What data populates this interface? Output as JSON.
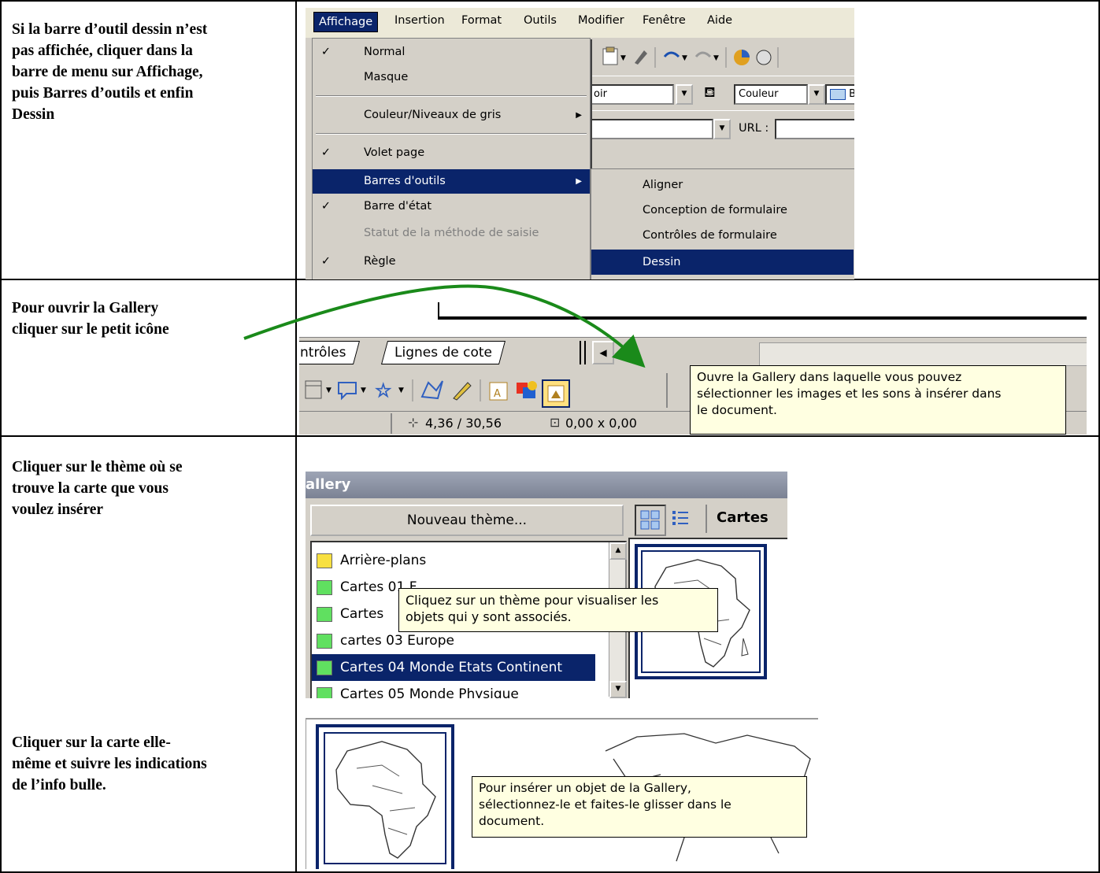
{
  "left_column": {
    "row1": "Si la barre d’outil dessin n’est\npas affichée, cliquer dans la\nbarre de menu sur Affichage,\npuis Barres d’outils et enfin\nDessin",
    "row2": "Pour ouvrir la Gallery\ncliquer sur le petit icône",
    "row3": "Cliquer sur le thème où se\ntrouve la carte que vous\nvoulez insérer",
    "row4": "Cliquer sur la carte elle-\nmême et suivre les indications\nde l’info bulle."
  },
  "menubar": {
    "items": [
      "Affichage",
      "Insertion",
      "Format",
      "Outils",
      "Modifier",
      "Fenêtre",
      "Aide"
    ]
  },
  "toolbar": {
    "combo_left": "oir",
    "combo_color": "Couleur",
    "combo_right": "B",
    "url_label": "URL :"
  },
  "affichage_menu": {
    "items": [
      {
        "label": "Normal",
        "checked": "✓"
      },
      {
        "label": "Masque",
        "checked": ""
      },
      {
        "label": "Couleur/Niveaux de gris",
        "checked": "",
        "arrow": "▶"
      },
      {
        "label": "Volet page",
        "checked": "✓"
      },
      {
        "label": "Barres d'outils",
        "checked": "",
        "arrow": "▶"
      },
      {
        "label": "Barre d'état",
        "checked": "✓"
      },
      {
        "label": "Statut de la méthode de saisie",
        "checked": ""
      },
      {
        "label": "Règle",
        "checked": "✓"
      }
    ]
  },
  "submenu": {
    "items": [
      "Aligner",
      "Conception de formulaire",
      "Contrôles de formulaire",
      "Dessin"
    ]
  },
  "drawing_bar": {
    "tab1": "ntrôles",
    "tab2": "Lignes de cote",
    "position": "4,36 / 30,56",
    "size": "0,00 x 0,00",
    "tooltip": "Ouvre la Gallery dans laquelle vous pouvez\nsélectionner les images et les sons à insérer dans\nle document."
  },
  "gallery": {
    "title": "allery",
    "new_theme_button": "Nouveau thème...",
    "current_theme": "Cartes",
    "themes": [
      "Arrière-plans",
      "Cartes 01 F",
      "Cartes",
      "cartes 03 Europe",
      "Cartes 04 Monde Etats Continent",
      "Cartes 05 Monde Physique"
    ],
    "tooltip": "Cliquez sur un thème pour visualiser les\nobjets qui y sont associés."
  },
  "gallery_item": {
    "tooltip": "Pour insérer un objet de la Gallery,\nsélectionnez-le et faites-le glisser dans le\ndocument."
  },
  "colors": {
    "menu_highlight": "#0a246a",
    "tooltip_bg": "#ffffe1",
    "arrow": "#1a8a1a"
  }
}
